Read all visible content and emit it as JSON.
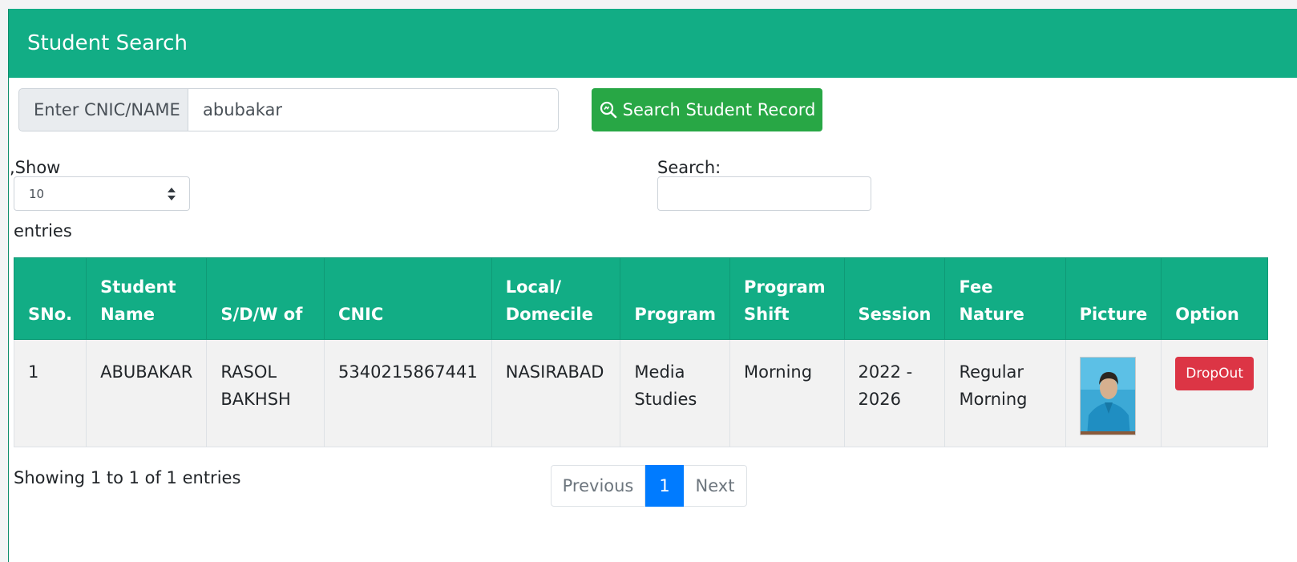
{
  "header": {
    "title": "Student Search"
  },
  "search": {
    "addon_label": "Enter CNIC/NAME",
    "value": "abubakar",
    "button_label": "Search Student Record"
  },
  "length": {
    "show_label": ",Show",
    "value": "10",
    "entries_label": "entries"
  },
  "filter": {
    "label": "Search:",
    "value": ""
  },
  "table": {
    "columns": {
      "sno": "SNo.",
      "name_l1": "Student",
      "name_l2": "Name",
      "father": "S/D/W of",
      "cnic": "CNIC",
      "local_l1": "Local/",
      "local_l2": "Domecile",
      "program": "Program",
      "shift_l1": "Program",
      "shift_l2": "Shift",
      "session": "Session",
      "fee": "Fee Nature",
      "picture": "Picture",
      "option": "Option"
    },
    "rows": [
      {
        "sno": "1",
        "name": "ABUBAKAR",
        "father_l1": "RASOL",
        "father_l2": "BAKHSH",
        "cnic": "5340215867441",
        "local": "NASIRABAD",
        "program_l1": "Media",
        "program_l2": "Studies",
        "shift": "Morning",
        "session_l1": "2022 -",
        "session_l2": "2026",
        "fee_l1": "Regular",
        "fee_l2": "Morning",
        "action_label": "DropOut"
      }
    ]
  },
  "footer": {
    "info": "Showing 1 to 1 of 1 entries",
    "pagination": {
      "previous": "Previous",
      "current": "1",
      "next": "Next"
    }
  },
  "colors": {
    "header_green": "#12ad85",
    "button_green": "#28a745",
    "danger_red": "#dc3545",
    "page_active_blue": "#007bff"
  }
}
